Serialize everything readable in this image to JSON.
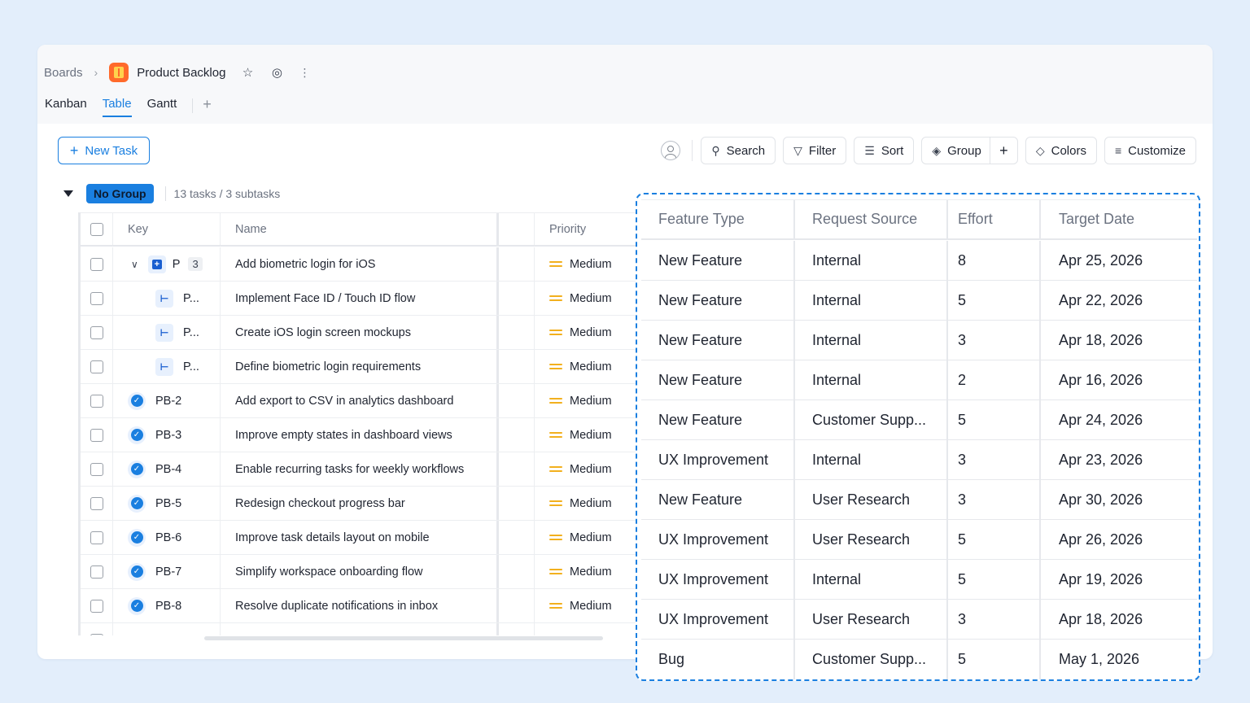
{
  "breadcrumb": {
    "boards": "Boards",
    "separator": "›",
    "board_title": "Product Backlog"
  },
  "views": {
    "tabs": [
      "Kanban",
      "Table",
      "Gantt"
    ],
    "active": "Table",
    "add": "+"
  },
  "toolbar": {
    "new_task": "New Task",
    "search": "Search",
    "filter": "Filter",
    "sort": "Sort",
    "group": "Group",
    "colors": "Colors",
    "customize": "Customize"
  },
  "group": {
    "label": "No Group",
    "count": "13 tasks / 3 subtasks"
  },
  "table": {
    "headers": {
      "key": "Key",
      "name": "Name",
      "priority": "Priority"
    },
    "rows": [
      {
        "key": "P",
        "count": "3",
        "name": "Add biometric login for iOS",
        "priority": "Medium",
        "kind": "epic"
      },
      {
        "key": "P...",
        "name": "Implement Face ID / Touch ID flow",
        "priority": "Medium",
        "kind": "subtask"
      },
      {
        "key": "P...",
        "name": "Create iOS login screen mockups",
        "priority": "Medium",
        "kind": "subtask"
      },
      {
        "key": "P...",
        "name": "Define biometric login requirements",
        "priority": "Medium",
        "kind": "subtask"
      },
      {
        "key": "PB-2",
        "name": "Add export to CSV in analytics dashboard",
        "priority": "Medium",
        "kind": "story"
      },
      {
        "key": "PB-3",
        "name": "Improve empty states in dashboard views",
        "priority": "Medium",
        "kind": "story"
      },
      {
        "key": "PB-4",
        "name": "Enable recurring tasks for weekly workflows",
        "priority": "Medium",
        "kind": "story"
      },
      {
        "key": "PB-5",
        "name": "Redesign checkout progress bar",
        "priority": "Medium",
        "kind": "story"
      },
      {
        "key": "PB-6",
        "name": "Improve task details layout on mobile",
        "priority": "Medium",
        "kind": "story"
      },
      {
        "key": "PB-7",
        "name": "Simplify workspace onboarding flow",
        "priority": "Medium",
        "kind": "story"
      },
      {
        "key": "PB-8",
        "name": "Resolve duplicate notifications in inbox",
        "priority": "Medium",
        "kind": "story"
      }
    ]
  },
  "detail": {
    "headers": [
      "Feature Type",
      "Request Source",
      "Effort",
      "Target Date"
    ],
    "rows": [
      [
        "New Feature",
        "Internal",
        "8",
        "Apr 25, 2026"
      ],
      [
        "New Feature",
        "Internal",
        "5",
        "Apr 22, 2026"
      ],
      [
        "New Feature",
        "Internal",
        "3",
        "Apr 18, 2026"
      ],
      [
        "New Feature",
        "Internal",
        "2",
        "Apr 16, 2026"
      ],
      [
        "New Feature",
        "Customer Supp...",
        "5",
        "Apr 24, 2026"
      ],
      [
        "UX Improvement",
        "Internal",
        "3",
        "Apr 23, 2026"
      ],
      [
        "New Feature",
        "User Research",
        "3",
        "Apr 30, 2026"
      ],
      [
        "UX Improvement",
        "User Research",
        "5",
        "Apr 26, 2026"
      ],
      [
        "UX Improvement",
        "Internal",
        "5",
        "Apr 19, 2026"
      ],
      [
        "UX Improvement",
        "User Research",
        "3",
        "Apr 18, 2026"
      ],
      [
        "Bug",
        "Customer Supp...",
        "5",
        "May 1, 2026"
      ]
    ]
  },
  "colors": {
    "accent": "#1a7fe0",
    "priority_medium": "#f2b01e",
    "board_logo": "#ff6a2b"
  },
  "icons": [
    "star-icon",
    "watch-icon",
    "more-icon",
    "search-icon",
    "filter-icon",
    "sort-icon",
    "group-icon",
    "colors-icon",
    "customize-icon",
    "user-icon",
    "plus-icon",
    "chevron-right-icon",
    "caret-down-icon",
    "expand-icon",
    "epic-icon",
    "subtask-icon",
    "story-icon",
    "priority-medium-icon"
  ]
}
